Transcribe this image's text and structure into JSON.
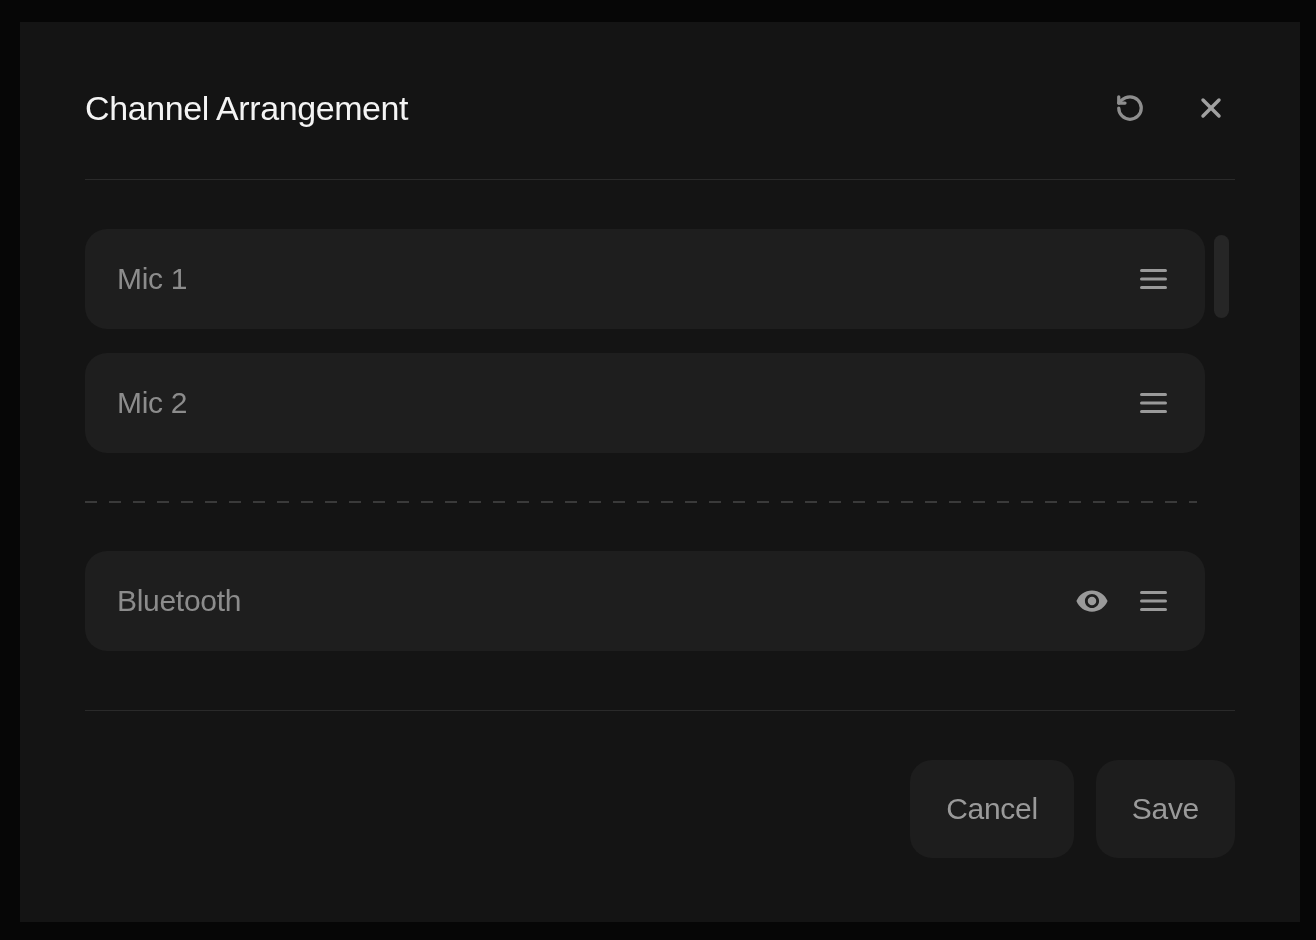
{
  "dialog": {
    "title": "Channel Arrangement"
  },
  "channel_groups": [
    {
      "channels": [
        {
          "name": "Mic 1",
          "visibility_icon": false
        },
        {
          "name": "Mic 2",
          "visibility_icon": false
        }
      ]
    },
    {
      "channels": [
        {
          "name": "Bluetooth",
          "visibility_icon": true
        }
      ]
    }
  ],
  "buttons": [
    {
      "label": "Cancel"
    },
    {
      "label": "Save"
    }
  ]
}
